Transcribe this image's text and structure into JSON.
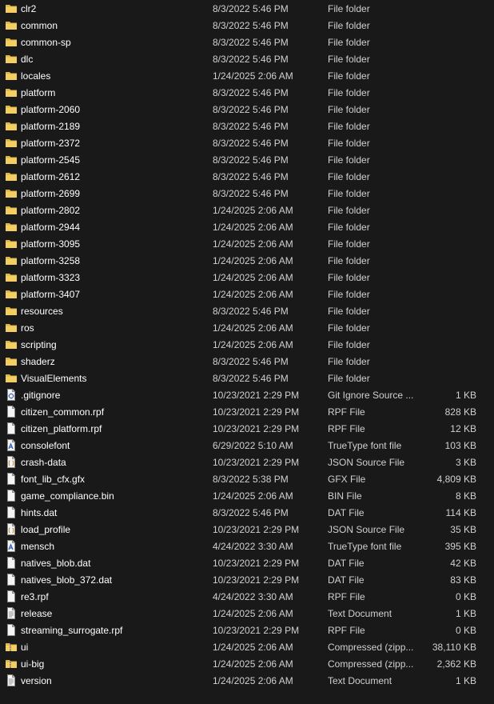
{
  "files": [
    {
      "name": "clr2",
      "date": "8/3/2022 5:46 PM",
      "type": "File folder",
      "size": "",
      "icon": "folder-icon"
    },
    {
      "name": "common",
      "date": "8/3/2022 5:46 PM",
      "type": "File folder",
      "size": "",
      "icon": "folder-icon"
    },
    {
      "name": "common-sp",
      "date": "8/3/2022 5:46 PM",
      "type": "File folder",
      "size": "",
      "icon": "folder-icon"
    },
    {
      "name": "dlc",
      "date": "8/3/2022 5:46 PM",
      "type": "File folder",
      "size": "",
      "icon": "folder-icon"
    },
    {
      "name": "locales",
      "date": "1/24/2025 2:06 AM",
      "type": "File folder",
      "size": "",
      "icon": "folder-icon"
    },
    {
      "name": "platform",
      "date": "8/3/2022 5:46 PM",
      "type": "File folder",
      "size": "",
      "icon": "folder-icon"
    },
    {
      "name": "platform-2060",
      "date": "8/3/2022 5:46 PM",
      "type": "File folder",
      "size": "",
      "icon": "folder-icon"
    },
    {
      "name": "platform-2189",
      "date": "8/3/2022 5:46 PM",
      "type": "File folder",
      "size": "",
      "icon": "folder-icon"
    },
    {
      "name": "platform-2372",
      "date": "8/3/2022 5:46 PM",
      "type": "File folder",
      "size": "",
      "icon": "folder-icon"
    },
    {
      "name": "platform-2545",
      "date": "8/3/2022 5:46 PM",
      "type": "File folder",
      "size": "",
      "icon": "folder-icon"
    },
    {
      "name": "platform-2612",
      "date": "8/3/2022 5:46 PM",
      "type": "File folder",
      "size": "",
      "icon": "folder-icon"
    },
    {
      "name": "platform-2699",
      "date": "8/3/2022 5:46 PM",
      "type": "File folder",
      "size": "",
      "icon": "folder-icon"
    },
    {
      "name": "platform-2802",
      "date": "1/24/2025 2:06 AM",
      "type": "File folder",
      "size": "",
      "icon": "folder-icon"
    },
    {
      "name": "platform-2944",
      "date": "1/24/2025 2:06 AM",
      "type": "File folder",
      "size": "",
      "icon": "folder-icon"
    },
    {
      "name": "platform-3095",
      "date": "1/24/2025 2:06 AM",
      "type": "File folder",
      "size": "",
      "icon": "folder-icon"
    },
    {
      "name": "platform-3258",
      "date": "1/24/2025 2:06 AM",
      "type": "File folder",
      "size": "",
      "icon": "folder-icon"
    },
    {
      "name": "platform-3323",
      "date": "1/24/2025 2:06 AM",
      "type": "File folder",
      "size": "",
      "icon": "folder-icon"
    },
    {
      "name": "platform-3407",
      "date": "1/24/2025 2:06 AM",
      "type": "File folder",
      "size": "",
      "icon": "folder-icon"
    },
    {
      "name": "resources",
      "date": "8/3/2022 5:46 PM",
      "type": "File folder",
      "size": "",
      "icon": "folder-icon"
    },
    {
      "name": "ros",
      "date": "1/24/2025 2:06 AM",
      "type": "File folder",
      "size": "",
      "icon": "folder-icon"
    },
    {
      "name": "scripting",
      "date": "1/24/2025 2:06 AM",
      "type": "File folder",
      "size": "",
      "icon": "folder-icon"
    },
    {
      "name": "shaderz",
      "date": "8/3/2022 5:46 PM",
      "type": "File folder",
      "size": "",
      "icon": "folder-icon"
    },
    {
      "name": "VisualElements",
      "date": "8/3/2022 5:46 PM",
      "type": "File folder",
      "size": "",
      "icon": "folder-icon"
    },
    {
      "name": ".gitignore",
      "date": "10/23/2021 2:29 PM",
      "type": "Git Ignore Source ...",
      "size": "1 KB",
      "icon": "git-file-icon"
    },
    {
      "name": "citizen_common.rpf",
      "date": "10/23/2021 2:29 PM",
      "type": "RPF File",
      "size": "828 KB",
      "icon": "file-icon"
    },
    {
      "name": "citizen_platform.rpf",
      "date": "10/23/2021 2:29 PM",
      "type": "RPF File",
      "size": "12 KB",
      "icon": "file-icon"
    },
    {
      "name": "consolefont",
      "date": "6/29/2022 5:10 AM",
      "type": "TrueType font file",
      "size": "103 KB",
      "icon": "font-file-icon"
    },
    {
      "name": "crash-data",
      "date": "10/23/2021 2:29 PM",
      "type": "JSON Source File",
      "size": "3 KB",
      "icon": "json-file-icon"
    },
    {
      "name": "font_lib_cfx.gfx",
      "date": "8/3/2022 5:38 PM",
      "type": "GFX File",
      "size": "4,809 KB",
      "icon": "file-icon"
    },
    {
      "name": "game_compliance.bin",
      "date": "1/24/2025 2:06 AM",
      "type": "BIN File",
      "size": "8 KB",
      "icon": "file-icon"
    },
    {
      "name": "hints.dat",
      "date": "8/3/2022 5:46 PM",
      "type": "DAT File",
      "size": "114 KB",
      "icon": "file-icon"
    },
    {
      "name": "load_profile",
      "date": "10/23/2021 2:29 PM",
      "type": "JSON Source File",
      "size": "35 KB",
      "icon": "json-file-icon"
    },
    {
      "name": "mensch",
      "date": "4/24/2022 3:30 AM",
      "type": "TrueType font file",
      "size": "395 KB",
      "icon": "font-file-icon"
    },
    {
      "name": "natives_blob.dat",
      "date": "10/23/2021 2:29 PM",
      "type": "DAT File",
      "size": "42 KB",
      "icon": "file-icon"
    },
    {
      "name": "natives_blob_372.dat",
      "date": "10/23/2021 2:29 PM",
      "type": "DAT File",
      "size": "83 KB",
      "icon": "file-icon"
    },
    {
      "name": "re3.rpf",
      "date": "4/24/2022 3:30 AM",
      "type": "RPF File",
      "size": "0 KB",
      "icon": "file-icon"
    },
    {
      "name": "release",
      "date": "1/24/2025 2:06 AM",
      "type": "Text Document",
      "size": "1 KB",
      "icon": "text-file-icon"
    },
    {
      "name": "streaming_surrogate.rpf",
      "date": "10/23/2021 2:29 PM",
      "type": "RPF File",
      "size": "0 KB",
      "icon": "file-icon"
    },
    {
      "name": "ui",
      "date": "1/24/2025 2:06 AM",
      "type": "Compressed (zipp...",
      "size": "38,110 KB",
      "icon": "zip-folder-icon"
    },
    {
      "name": "ui-big",
      "date": "1/24/2025 2:06 AM",
      "type": "Compressed (zipp...",
      "size": "2,362 KB",
      "icon": "zip-folder-icon"
    },
    {
      "name": "version",
      "date": "1/24/2025 2:06 AM",
      "type": "Text Document",
      "size": "1 KB",
      "icon": "text-file-icon"
    }
  ]
}
